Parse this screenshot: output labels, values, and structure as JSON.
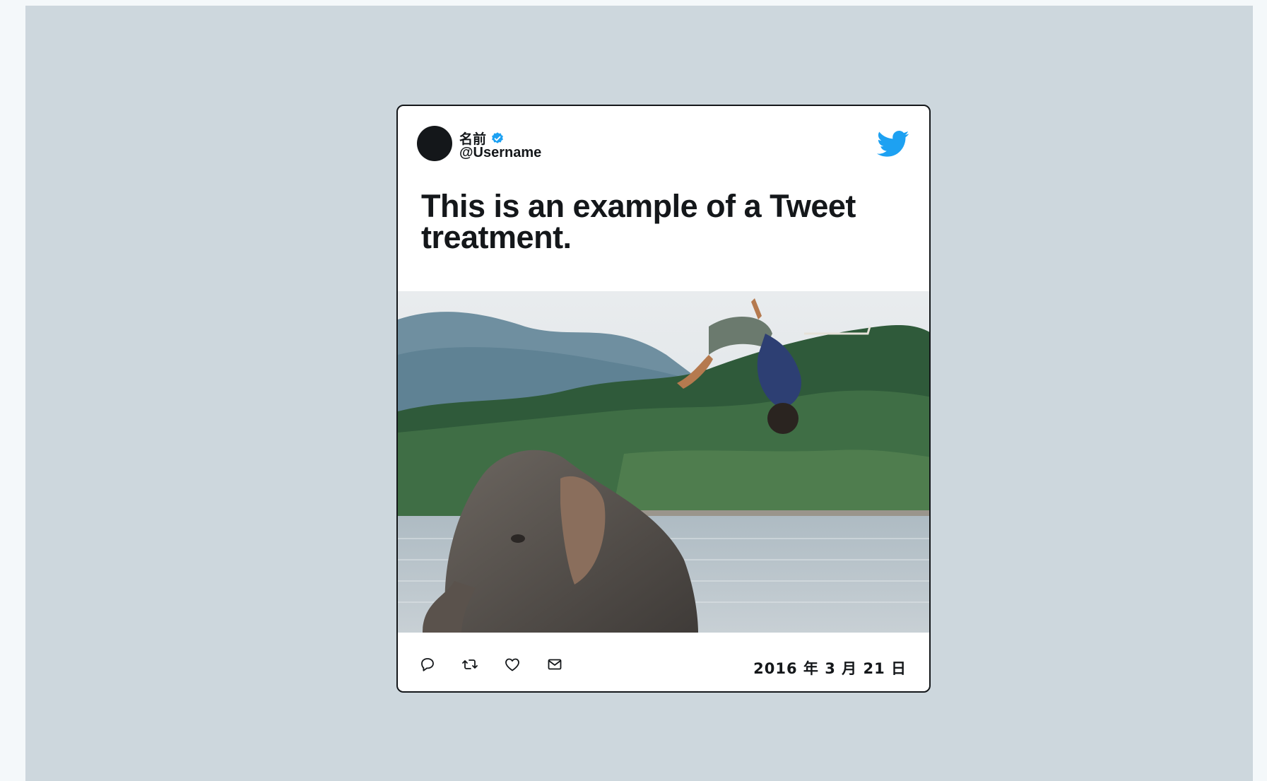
{
  "tweet": {
    "display_name": "名前",
    "username": "@Username",
    "text": "This is an example of a Tweet treatment.",
    "date": "2016 年 3 月 21 日",
    "verified": true
  },
  "icons": {
    "brand": "twitter-bird-icon",
    "verified": "verified-badge-icon",
    "actions": [
      "reply-icon",
      "retweet-icon",
      "like-icon",
      "share-dm-icon"
    ]
  },
  "colors": {
    "brand": "#1da1f2",
    "text": "#14171a",
    "stage": "#cdd7dd",
    "page": "#f4f8fa"
  }
}
